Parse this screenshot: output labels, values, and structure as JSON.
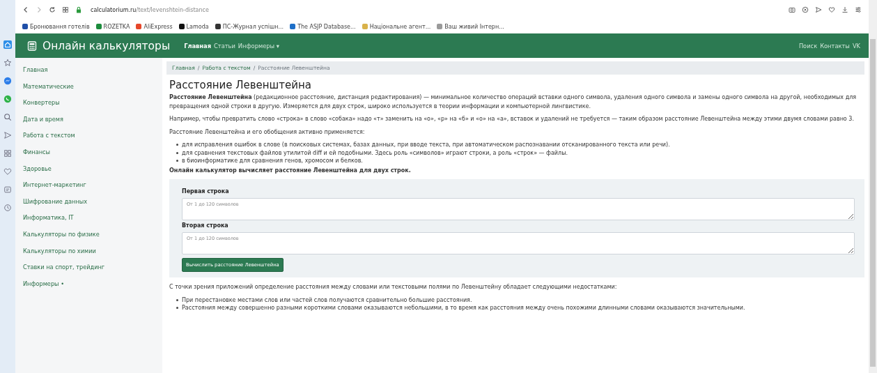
{
  "browser": {
    "address": {
      "host": "calculatorium.ru",
      "path": "/text/levenshtein-distance"
    },
    "bookmarks": [
      {
        "label": "Бронювання готелів",
        "color": "#1f4fa8"
      },
      {
        "label": "ROZETKA",
        "color": "#1c8c3c"
      },
      {
        "label": "AliExpress",
        "color": "#e6462a"
      },
      {
        "label": "Lamoda",
        "color": "#111111"
      },
      {
        "label": "ПС-Журнал успішн...",
        "color": "#333333"
      },
      {
        "label": "The ASJP Database...",
        "color": "#1e6fc8"
      },
      {
        "label": "Національне агент...",
        "color": "#d9b24a"
      },
      {
        "label": "Ваш живий Інтерн...",
        "color": "#9a9a9a"
      }
    ]
  },
  "site": {
    "brand": "Онлайн калькуляторы",
    "nav": [
      {
        "label": "Главная",
        "selected": true
      },
      {
        "label": "Статьи",
        "selected": false
      },
      {
        "label": "Информеры ▾",
        "selected": false
      }
    ],
    "nav_right": [
      "Поиск",
      "Контакты",
      "VK"
    ]
  },
  "sidebar": {
    "items": [
      "Главная",
      "Математические",
      "Конвертеры",
      "Дата и время",
      "Работа с текстом",
      "Финансы",
      "Здоровье",
      "Интернет-маркетинг",
      "Шифрование данных",
      "Информатика, IT",
      "Калькуляторы по физике",
      "Калькуляторы по химии",
      "Ставки на спорт, трейдинг",
      "Информеры •"
    ]
  },
  "breadcrumb": [
    {
      "label": "Главная",
      "link": true
    },
    {
      "separator": "/",
      "label": "Работа с текстом",
      "link": true
    },
    {
      "separator": "/",
      "label": "Расстояние Левенштейна",
      "link": false
    }
  ],
  "title": "Расстояние Левенштейна",
  "paragraphs": [
    "**Расстояние Левенштейна** (редакционное расстояние, дистанция редактирования) — минимальное количество операций вставки одного символа, удаления одного символа и замены одного символа на другой, необходимых для превращения одной строки в другую. Измеряется для двух строк, широко используется в теории информации и компьютерной лингвистике.",
    "Например, чтобы превратить слово «строка» в слово «собака» надо «т» заменить на «о», «р» на «б» и «о» на «а», вставок и удалений не требуется — таким образом расстояние Левенштейна между этими двумя словами равно 3.",
    "Расстояние Левенштейна и его обобщения активно применяется:"
  ],
  "uses": [
    "для исправления ошибок в слове (в поисковых системах, базах данных, при вводе текста, при автоматическом распознавании отсканированного текста или речи).",
    "для сравнения текстовых файлов утилитой diff и ей подобными. Здесь роль «символов» играют строки, а роль «строк» — файлы.",
    "в биоинформатике для сравнения генов, хромосом и белков."
  ],
  "calculator": {
    "lead": "Онлайн калькулятор вычисляет расстояние Левенштейна для двух строк.",
    "fields": [
      {
        "label": "Первая строка",
        "placeholder": "От 1 до 120 символов"
      },
      {
        "label": "Вторая строка",
        "placeholder": "От 1 до 120 символов"
      }
    ],
    "button": "Вычислить расстояние Левенштейна"
  },
  "drawbacks_intro": "С точки зрения приложений определение расстояния между словами или текстовыми полями по Левенштейну обладает следующими недостатками:",
  "drawbacks": [
    "При перестановке местами слов или частей слов получаются сравнительно большие расстояния.",
    "Расстояния между совершенно разными короткими словами оказываются небольшими, в то время как расстояния между очень похожими длинными словами оказываются значительными."
  ]
}
